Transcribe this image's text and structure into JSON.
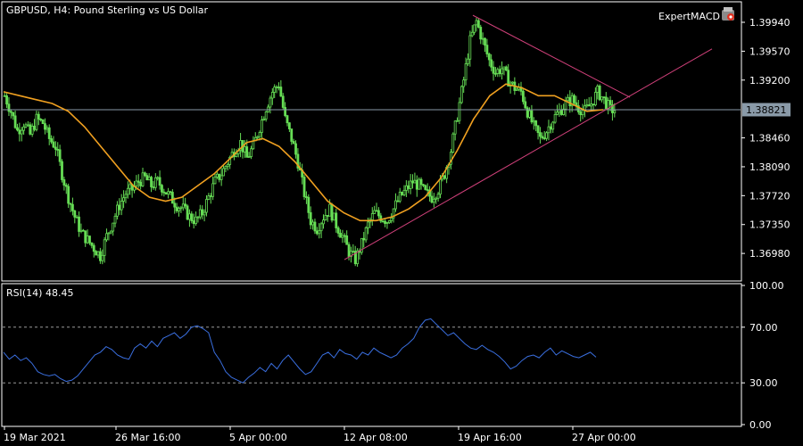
{
  "header": {
    "symbol_label": "GBPUSD, H4:  Pound Sterling vs US Dollar",
    "expert_label": "ExpertMACD"
  },
  "price_axis": {
    "ticks": [
      "1.39940",
      "1.39570",
      "1.39200",
      "1.38460",
      "1.38090",
      "1.37720",
      "1.37350",
      "1.36980"
    ],
    "current_price": "1.38821"
  },
  "rsi_panel": {
    "label": "RSI(14) 48.45",
    "ticks": [
      "100.00",
      "70.00",
      "30.00",
      "0.00"
    ]
  },
  "time_axis": {
    "ticks": [
      "19 Mar 2021",
      "26 Mar 16:00",
      "5 Apr 00:00",
      "12 Apr 08:00",
      "19 Apr 16:00",
      "27 Apr 00:00"
    ]
  },
  "colors": {
    "candle": "#66dd55",
    "ma": "#f0a020",
    "trendline": "#d0407a",
    "rsi": "#3a6fe0",
    "current_line": "#8a9aa8",
    "level_line": "#9a9a9a"
  },
  "chart_data": [
    {
      "type": "line",
      "title": "GBPUSD, H4:  Pound Sterling vs US Dollar",
      "y_ticks": [
        1.3994,
        1.3957,
        1.392,
        1.3846,
        1.3809,
        1.3772,
        1.3735,
        1.3698
      ],
      "ylim": [
        1.3665,
        1.4018
      ],
      "current_price": 1.38821,
      "x_tick_labels": [
        "19 Mar 2021",
        "26 Mar 16:00",
        "5 Apr 00:00",
        "12 Apr 08:00",
        "19 Apr 16:00",
        "27 Apr 00:00"
      ],
      "close": [
        1.39,
        1.388,
        1.3855,
        1.3865,
        1.385,
        1.387,
        1.3865,
        1.3845,
        1.3835,
        1.38,
        1.377,
        1.3745,
        1.3725,
        1.3715,
        1.3705,
        1.3695,
        1.372,
        1.374,
        1.376,
        1.3775,
        1.378,
        1.379,
        1.3795,
        1.3785,
        1.379,
        1.378,
        1.377,
        1.376,
        1.3755,
        1.3745,
        1.374,
        1.375,
        1.377,
        1.379,
        1.38,
        1.3815,
        1.383,
        1.384,
        1.382,
        1.3835,
        1.386,
        1.3885,
        1.3905,
        1.3915,
        1.387,
        1.3845,
        1.3815,
        1.3775,
        1.374,
        1.373,
        1.3745,
        1.3755,
        1.3735,
        1.372,
        1.37,
        1.369,
        1.371,
        1.3735,
        1.375,
        1.3745,
        1.374,
        1.3755,
        1.377,
        1.378,
        1.379,
        1.3785,
        1.3775,
        1.377,
        1.378,
        1.38,
        1.383,
        1.3875,
        1.392,
        1.397,
        1.3995,
        1.397,
        1.3945,
        1.393,
        1.3935,
        1.392,
        1.391,
        1.3905,
        1.388,
        1.386,
        1.3845,
        1.3855,
        1.387,
        1.388,
        1.389,
        1.3895,
        1.3885,
        1.388,
        1.389,
        1.3905,
        1.3895,
        1.3882
      ],
      "ma": [
        1.3905,
        1.39,
        1.3895,
        1.389,
        1.388,
        1.386,
        1.3835,
        1.381,
        1.3785,
        1.377,
        1.3765,
        1.377,
        1.3785,
        1.38,
        1.382,
        1.384,
        1.3845,
        1.3835,
        1.3815,
        1.379,
        1.3765,
        1.375,
        1.374,
        1.374,
        1.3745,
        1.3755,
        1.377,
        1.3795,
        1.383,
        1.387,
        1.39,
        1.3915,
        1.391,
        1.39,
        1.39,
        1.389,
        1.388,
        1.3882
      ],
      "trendlines": [
        {
          "from": [
            0.0,
            1.37
          ],
          "to": [
            1.0,
            1.398
          ]
        },
        {
          "from": [
            0.0,
            1.3998
          ],
          "to": [
            1.0,
            1.3877
          ]
        }
      ]
    },
    {
      "type": "line",
      "title": "RSI(14) 48.45",
      "ylim": [
        0,
        100
      ],
      "y_ticks": [
        100,
        70,
        30,
        0
      ],
      "levels": [
        70,
        30
      ],
      "series": [
        {
          "name": "RSI(14)",
          "values": [
            52,
            47,
            50,
            46,
            48,
            44,
            38,
            36,
            35,
            36,
            33,
            31,
            32,
            35,
            40,
            45,
            50,
            52,
            56,
            54,
            50,
            48,
            47,
            55,
            58,
            55,
            60,
            56,
            62,
            64,
            66,
            62,
            65,
            70,
            71,
            69,
            66,
            52,
            46,
            38,
            34,
            32,
            30,
            34,
            37,
            41,
            38,
            44,
            40,
            46,
            50,
            45,
            40,
            36,
            38,
            44,
            50,
            52,
            48,
            54,
            51,
            50,
            47,
            52,
            50,
            55,
            52,
            50,
            48,
            50,
            55,
            58,
            62,
            70,
            75,
            76,
            72,
            68,
            64,
            66,
            62,
            58,
            55,
            54,
            57,
            54,
            52,
            49,
            45,
            40,
            42,
            46,
            49,
            50,
            48,
            52,
            55,
            50,
            53,
            51,
            49,
            48,
            50,
            52,
            48.45
          ]
        }
      ]
    }
  ]
}
